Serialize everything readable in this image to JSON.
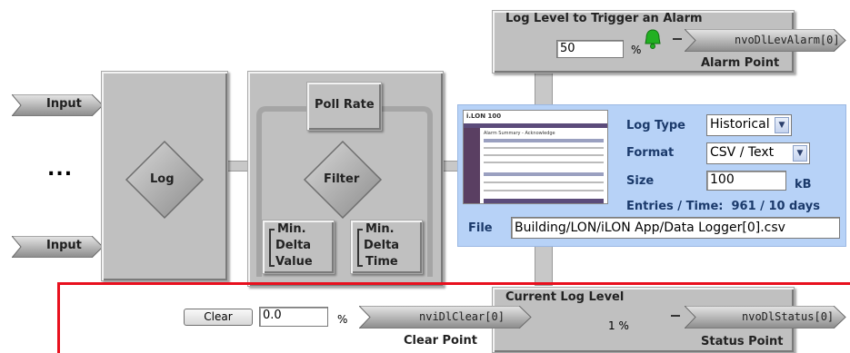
{
  "inputs": {
    "top_label": "Input",
    "bottom_label": "Input",
    "ellipsis": "..."
  },
  "blocks": {
    "log_label": "Log",
    "poll_rate_label": "Poll Rate",
    "filter_label": "Filter",
    "min_delta_value": [
      "Min.",
      "Delta",
      "Value"
    ],
    "min_delta_time": [
      "Min.",
      "Delta",
      "Time"
    ]
  },
  "alarm": {
    "title": "Log Level to Trigger an Alarm",
    "value": "50",
    "unit": "%",
    "output_pin": "nvoDlLevAlarm[0]",
    "point_label": "Alarm Point"
  },
  "log_settings": {
    "log_type_label": "Log Type",
    "log_type_value": "Historical",
    "format_label": "Format",
    "format_value": "CSV / Text",
    "size_label": "Size",
    "size_value": "100",
    "size_unit": "kB",
    "entries_text": "Entries / Time:  961 / 10 days",
    "file_label": "File",
    "file_value": "Building/LON/iLON App/Data Logger[0].csv",
    "thumbnail_brand": "i.LON 100",
    "thumbnail_heading": "Alarm Summary - Acknowledge"
  },
  "clear": {
    "button_label": "Clear",
    "value": "0.0",
    "unit": "%",
    "input_pin": "nviDlClear[0]",
    "point_label": "Clear Point"
  },
  "status": {
    "title": "Current Log Level",
    "value": "1 %",
    "output_pin": "nvoDlStatus[0]",
    "point_label": "Status Point"
  },
  "colors": {
    "red_line": "#e8101e",
    "panel_blue": "#b7d2f7",
    "label_blue": "#1b3a6b",
    "bell_green": "#22b022"
  }
}
